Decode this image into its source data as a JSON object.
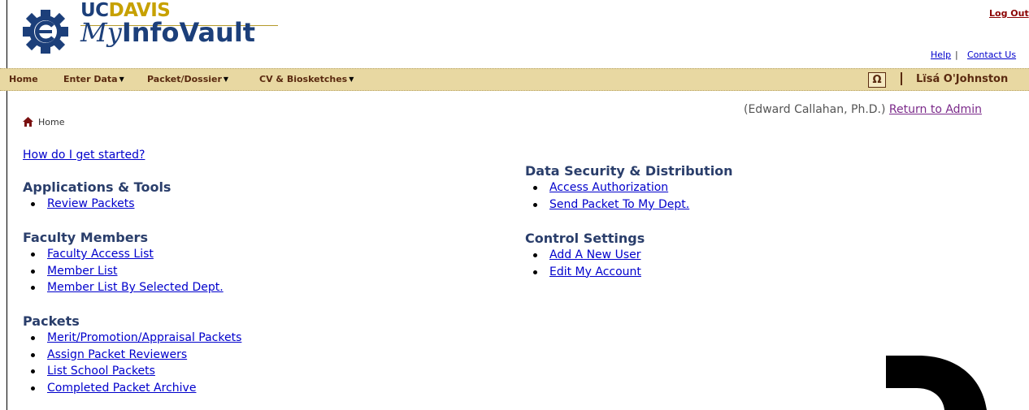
{
  "header": {
    "brand_uc": "UC",
    "brand_davis": "DAVIS",
    "brand_my": "My",
    "brand_infovault": "InfoVault",
    "logout": "Log Out",
    "help": "Help",
    "separator": "|",
    "contact": "Contact Us"
  },
  "nav": {
    "home": "Home",
    "enter_data": "Enter Data",
    "packet_dossier": "Packet/Dossier",
    "cv_biosketches": "CV & Biosketches",
    "special_chars": "Ω",
    "username": "Lïsá O'Johnston"
  },
  "proxy": {
    "name": "(Edward Callahan, Ph.D.)",
    "return_link": "Return to Admin"
  },
  "breadcrumb": {
    "home": "Home"
  },
  "content": {
    "getting_started": "How do I get started?",
    "applications": {
      "title": "Applications & Tools",
      "items": [
        "Review Packets"
      ]
    },
    "faculty": {
      "title": "Faculty Members",
      "items": [
        "Faculty Access List",
        "Member List",
        "Member List By Selected Dept."
      ]
    },
    "packets": {
      "title": "Packets",
      "items": [
        "Merit/Promotion/Appraisal Packets",
        "Assign Packet Reviewers",
        "List School Packets",
        "Completed Packet Archive"
      ]
    },
    "data_security": {
      "title": "Data Security & Distribution",
      "items": [
        "Access Authorization",
        "Send Packet To My Dept."
      ]
    },
    "control": {
      "title": "Control Settings",
      "items": [
        "Add A New User",
        "Edit My Account"
      ]
    }
  },
  "colors": {
    "navbar": "#e8d8a2",
    "navtext": "#5a2a10",
    "heading": "#2a3e6b",
    "link": "#0000cc",
    "gold": "#c7a100"
  }
}
